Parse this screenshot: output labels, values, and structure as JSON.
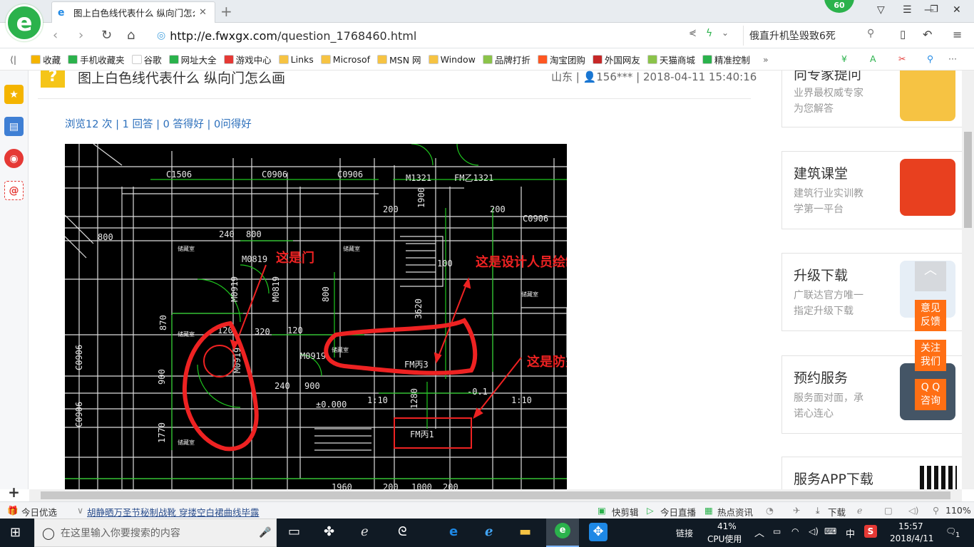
{
  "browser": {
    "badge": "60",
    "tab_title": "图上白色线代表什么 纵向门怎么画",
    "url_host": "http://e.fwxgx.com",
    "url_path": "/question_1768460.html",
    "search_text": "俄直升机坠毁致6死"
  },
  "bookmarks": [
    {
      "label": "收藏",
      "color": "#f4b400"
    },
    {
      "label": "手机收藏夹",
      "color": "#2bb24c"
    },
    {
      "label": "谷歌",
      "color": "#ffffff"
    },
    {
      "label": "网址大全",
      "color": "#2bb24c"
    },
    {
      "label": "游戏中心",
      "color": "#e53935"
    },
    {
      "label": "Links",
      "color": "#f6c343"
    },
    {
      "label": "Microsof",
      "color": "#f6c343"
    },
    {
      "label": "MSN 网",
      "color": "#f6c343"
    },
    {
      "label": "Window",
      "color": "#f6c343"
    },
    {
      "label": "品牌打折",
      "color": "#8bc34a"
    },
    {
      "label": "淘宝团购",
      "color": "#ff5722"
    },
    {
      "label": "外国网友",
      "color": "#c62828"
    },
    {
      "label": "天猫商城",
      "color": "#8bc34a"
    },
    {
      "label": "精准控制",
      "color": "#2bb24c"
    }
  ],
  "question": {
    "title": "图上白色线代表什么 纵向门怎么画",
    "meta": "山东 | 👤156*** | 2018-04-11 15:40:16",
    "stats": "浏览12 次 | 1 回答 | 0 答得好 | 0问得好"
  },
  "cad": {
    "labels": [
      "C1506",
      "C0906",
      "C0906",
      "M1321",
      "FM乙1321",
      "C0906",
      "800",
      "240",
      "800",
      "M0819",
      "M0919",
      "M0819",
      "800",
      "870",
      "120",
      "320",
      "120",
      "M0919",
      "FM丙3",
      "M0919",
      "240",
      "900",
      "±0.000",
      "1:10",
      "1:10",
      "FM丙1",
      "-0.1",
      "1900",
      "200",
      "200",
      "3620",
      "1960",
      "1000",
      "200",
      "200",
      "C0906",
      "C0906",
      "1770",
      "900",
      "1280",
      "100"
    ],
    "room_label": "储藏室",
    "annotation_door": "这是门",
    "annotation_axis": "这是设计人员绘制图纸时候的轴线",
    "annotation_fire_door": "这是防火门"
  },
  "ads": [
    {
      "title": "向专家提问",
      "sub": "业界最权威专家\n为您解答"
    },
    {
      "title": "建筑课堂",
      "sub": "建筑行业实训教\n学第一平台"
    },
    {
      "title": "升级下载",
      "sub": "广联达官方唯一\n指定升级下载"
    },
    {
      "title": "预约服务",
      "sub": "服务面对面，承\n诺心连心"
    },
    {
      "title": "服务APP下载",
      "sub": ""
    }
  ],
  "float_buttons": [
    "意见\n反馈",
    "关注\n我们",
    "Q Q\n咨询"
  ],
  "statusbar": {
    "today": "今日优选",
    "news": "胡静晒万圣节秘制战靴 穿搂空白裙曲线毕露",
    "quick_cut": "快剪辑",
    "live": "今日直播",
    "hot": "热点资讯",
    "download": "下载",
    "zoom": "110%"
  },
  "taskbar": {
    "search_placeholder": "在这里输入你要搜索的内容",
    "link": "链接",
    "cpu_percent": "41%",
    "cpu_label": "CPU使用",
    "ime": "中",
    "time": "15:57",
    "date": "2018/4/11",
    "notify": "1"
  }
}
